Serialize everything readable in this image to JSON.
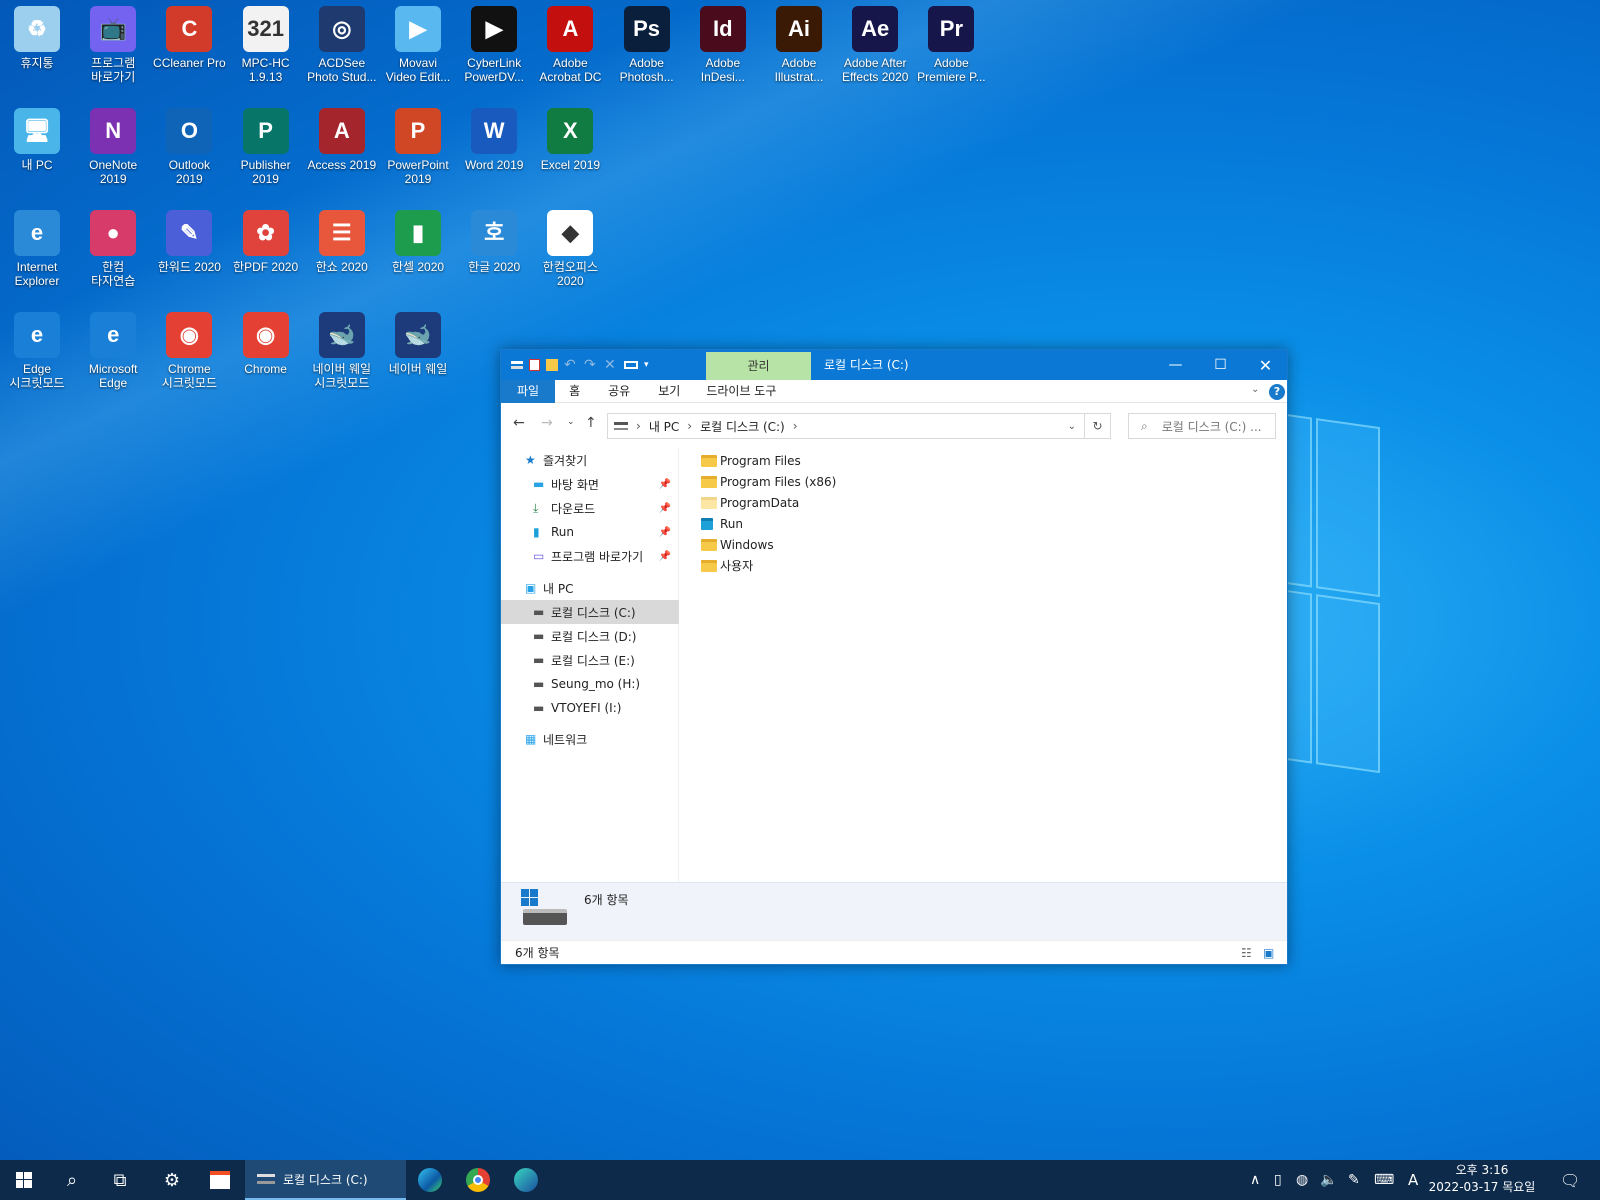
{
  "desktop": {
    "icons": [
      {
        "label": "휴지통",
        "icon": "recycle-bin-icon",
        "color": "#9ccfee",
        "glyph": "♻"
      },
      {
        "label": "프로그램\n바로가기",
        "icon": "tv-shortcut-icon",
        "color": "#7463f0",
        "glyph": "📺"
      },
      {
        "label": "CCleaner Pro",
        "icon": "ccleaner-icon",
        "color": "#d23b2a",
        "glyph": "C"
      },
      {
        "label": "MPC-HC\n1.9.13",
        "icon": "mpc-hc-icon",
        "color": "#f2f2f2",
        "glyph": "321"
      },
      {
        "label": "ACDSee\nPhoto Stud...",
        "icon": "acdsee-icon",
        "color": "#1e3a6e",
        "glyph": "◎"
      },
      {
        "label": "Movavi\nVideo Edit...",
        "icon": "movavi-icon",
        "color": "#5ab8f1",
        "glyph": "▶"
      },
      {
        "label": "CyberLink\nPowerDV...",
        "icon": "powerdvd-icon",
        "color": "#111",
        "glyph": "▶"
      },
      {
        "label": "Adobe\nAcrobat DC",
        "icon": "acrobat-icon",
        "color": "#c40f0f",
        "glyph": "A"
      },
      {
        "label": "Adobe\nPhotosh...",
        "icon": "photoshop-icon",
        "color": "#0a1f3b",
        "glyph": "Ps"
      },
      {
        "label": "Adobe\nInDesi...",
        "icon": "indesign-icon",
        "color": "#4a0b1d",
        "glyph": "Id"
      },
      {
        "label": "Adobe\nIllustrat...",
        "icon": "illustrator-icon",
        "color": "#3a1a05",
        "glyph": "Ai"
      },
      {
        "label": "Adobe After\nEffects 2020",
        "icon": "after-effects-icon",
        "color": "#16164a",
        "glyph": "Ae"
      },
      {
        "label": "Adobe\nPremiere P...",
        "icon": "premiere-icon",
        "color": "#16164a",
        "glyph": "Pr"
      },
      {
        "label": "내 PC",
        "icon": "this-pc-icon",
        "color": "#49b5e8",
        "glyph": "🖥"
      },
      {
        "label": "OneNote\n2019",
        "icon": "onenote-icon",
        "color": "#7b31b2",
        "glyph": "N"
      },
      {
        "label": "Outlook\n2019",
        "icon": "outlook-icon",
        "color": "#0f64b8",
        "glyph": "O"
      },
      {
        "label": "Publisher\n2019",
        "icon": "publisher-icon",
        "color": "#077568",
        "glyph": "P"
      },
      {
        "label": "Access 2019",
        "icon": "access-icon",
        "color": "#a4262c",
        "glyph": "A"
      },
      {
        "label": "PowerPoint\n2019",
        "icon": "powerpoint-icon",
        "color": "#d04726",
        "glyph": "P"
      },
      {
        "label": "Word 2019",
        "icon": "word-icon",
        "color": "#185abd",
        "glyph": "W"
      },
      {
        "label": "Excel 2019",
        "icon": "excel-icon",
        "color": "#107c41",
        "glyph": "X"
      },
      {
        "label": "Internet\nExplorer",
        "icon": "internet-explorer-icon",
        "color": "#2a8ad8",
        "glyph": "e"
      },
      {
        "label": "한컴\n타자연습",
        "icon": "hancom-typing-icon",
        "color": "#d73b6a",
        "glyph": "●"
      },
      {
        "label": "한워드 2020",
        "icon": "hanword-icon",
        "color": "#4a5fd8",
        "glyph": "✎"
      },
      {
        "label": "한PDF 2020",
        "icon": "hanpdf-icon",
        "color": "#e0433b",
        "glyph": "✿"
      },
      {
        "label": "한쇼 2020",
        "icon": "hanshow-icon",
        "color": "#e8573b",
        "glyph": "☰"
      },
      {
        "label": "한셀 2020",
        "icon": "hancell-icon",
        "color": "#1e9c4e",
        "glyph": "▮"
      },
      {
        "label": "한글 2020",
        "icon": "hangul-icon",
        "color": "#2a8ad8",
        "glyph": "호"
      },
      {
        "label": "한컴오피스\n2020",
        "icon": "hancom-office-icon",
        "color": "#ffffff",
        "glyph": "◆"
      },
      {
        "label": "Edge\n시크릿모드",
        "icon": "edge-private-icon",
        "color": "#1a7fd6",
        "glyph": "e"
      },
      {
        "label": "Microsoft\nEdge",
        "icon": "edge-icon",
        "color": "#1a7fd6",
        "glyph": "e"
      },
      {
        "label": "Chrome\n시크릿모드",
        "icon": "chrome-incognito-icon",
        "color": "#e44134",
        "glyph": "◉"
      },
      {
        "label": "Chrome",
        "icon": "chrome-icon",
        "color": "#e44134",
        "glyph": "◉"
      },
      {
        "label": "네이버 웨일\n시크릿모드",
        "icon": "whale-private-icon",
        "color": "#1d3a7a",
        "glyph": "🐋"
      },
      {
        "label": "네이버 웨일",
        "icon": "whale-icon",
        "color": "#1d3a7a",
        "glyph": "🐋"
      }
    ]
  },
  "explorer": {
    "context_tab": "관리",
    "title": "로컬 디스크 (C:)",
    "ribbon_tabs": [
      "파일",
      "홈",
      "공유",
      "보기",
      "드라이브 도구"
    ],
    "address": [
      "내 PC",
      "로컬 디스크 (C:)"
    ],
    "search_placeholder": "로컬 디스크 (C:) ...",
    "nav": {
      "quick_access": "즐겨찾기",
      "quick_items": [
        "바탕 화면",
        "다운로드",
        "Run",
        "프로그램 바로가기"
      ],
      "this_pc": "내 PC",
      "drives": [
        "로컬 디스크 (C:)",
        "로컬 디스크 (D:)",
        "로컬 디스크 (E:)",
        "Seung_mo (H:)",
        "VTOYEFI (I:)"
      ],
      "network": "네트워크"
    },
    "files": [
      "Program Files",
      "Program Files (x86)",
      "ProgramData",
      "Run",
      "Windows",
      "사용자"
    ],
    "detail_count": "6개 항목",
    "status_count": "6개 항목"
  },
  "taskbar": {
    "active_window": "로컬 디스크 (C:)",
    "time": "오후 3:16",
    "date": "2022-03-17 목요일",
    "ime": "A"
  }
}
